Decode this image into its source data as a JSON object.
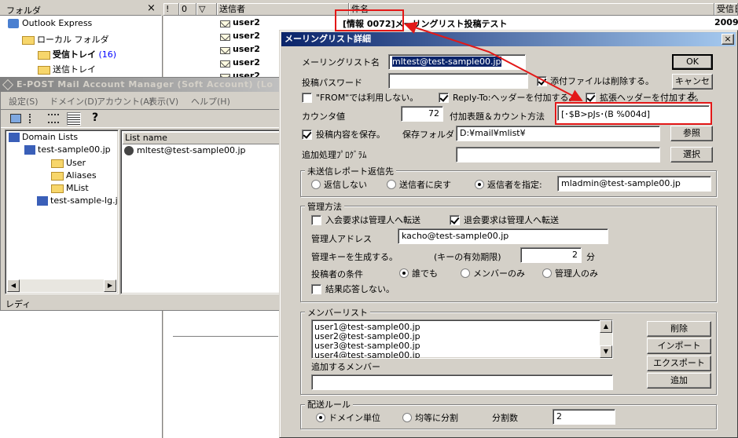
{
  "outlook": {
    "folder_header": "フォルダ",
    "close_label": "×",
    "tree": [
      {
        "label": "Outlook Express"
      },
      {
        "label": "ローカル フォルダ"
      },
      {
        "label": "受信トレイ",
        "count": "(16)"
      },
      {
        "label": "送信トレイ"
      }
    ],
    "columns": [
      "!",
      "0",
      "▽",
      "送信者",
      "件名",
      "受信日"
    ],
    "messages": [
      {
        "sender": "user2",
        "subject": "[情報 0072]メーリングリスト投稿テスト",
        "date": "2009/"
      },
      {
        "sender": "user2",
        "subject": "",
        "date": ""
      },
      {
        "sender": "user2",
        "subject": "",
        "date": ""
      },
      {
        "sender": "user2",
        "subject": "",
        "date": ""
      },
      {
        "sender": "user2",
        "subject": "",
        "date": ""
      }
    ]
  },
  "manager": {
    "title": "E-POST Mail Account Manager (Soft Account) (Lo",
    "menu": [
      "設定(S)",
      "ドメイン(D)",
      "アカウント(A)",
      "表示(V)",
      "ヘルプ(H)"
    ],
    "toolbar_help": "?",
    "tree": [
      {
        "label": "Domain Lists"
      },
      {
        "label": "test-sample00.jp"
      },
      {
        "label": "User"
      },
      {
        "label": "Aliases"
      },
      {
        "label": "MList"
      },
      {
        "label": "test-sample-lg.j"
      }
    ],
    "list_header": "List name",
    "list_items": [
      "mltest@test-sample00.jp"
    ],
    "status": "レディ"
  },
  "dialog": {
    "title": "メーリングリスト詳細",
    "close_label": "×",
    "ml_name_label": "メーリングリスト名",
    "ml_name_value": "mltest@test-sample00.jp",
    "post_password_label": "投稿パスワード",
    "post_password_value": "",
    "delete_attach_label": "添付ファイルは削除する。",
    "ok_label": "OK",
    "cancel_label": "キャンセル",
    "from_unused_label": "\"FROM\"では利用しない。",
    "reply_to_label": "Reply-To:ヘッダーを付加する。",
    "ext_header_label": "拡張ヘッダーを付加する。",
    "counter_label": "カウンタ値",
    "counter_value": "72",
    "subject_format_label": "付加表題＆カウント方法",
    "subject_format_value": "[･$B>pJs･(B %004d]",
    "save_post_label": "投稿内容を保存。",
    "save_folder_label": "保存フォルダ",
    "save_folder_value": "D:¥mail¥mlist¥",
    "browse_label": "参照",
    "extra_program_label": "追加処理ﾌﾟﾛｸﾞﾗﾑ",
    "extra_program_value": "",
    "select_label": "選択",
    "undelivered_group": "未送信レポート返信先",
    "undelivered_options": [
      "返信しない",
      "送信者に戻す",
      "返信者を指定:"
    ],
    "undelivered_address": "mladmin@test-sample00.jp",
    "admin_group": "管理方法",
    "join_forward_label": "入会要求は管理人へ転送",
    "leave_forward_label": "退会要求は管理人へ転送",
    "admin_address_label": "管理人アドレス",
    "admin_address_value": "kacho@test-sample00.jp",
    "admin_key_label": "管理キーを生成する。",
    "key_expiry_label": "(キーの有効期限)",
    "key_expiry_value": "2",
    "key_expiry_unit": "分",
    "poster_condition_label": "投稿者の条件",
    "poster_options": [
      "誰でも",
      "メンバーのみ",
      "管理人のみ"
    ],
    "result_reply_label": "結果応答しない。",
    "member_group": "メンバーリスト",
    "members": [
      "user1@test-sample00.jp",
      "user2@test-sample00.jp",
      "user3@test-sample00.jp",
      "user4@test-sample00.jp"
    ],
    "delete_label": "削除",
    "import_label": "インポート",
    "export_label": "エクスポート",
    "add_member_label": "追加するメンバー",
    "add_member_value": "",
    "add_label": "追加",
    "delivery_group": "配送ルール",
    "delivery_options": [
      "ドメイン単位",
      "均等に分割"
    ],
    "split_count_label": "分割数",
    "split_count_value": "2"
  },
  "colors": {
    "highlight_red": "#e31818",
    "title_blue": "#0a246a",
    "selection": "#0a246a"
  },
  "icons": [
    "close-icon",
    "envelope-icon",
    "folder-icon",
    "inbox-icon",
    "outbox-icon",
    "outlook-icon",
    "help-icon",
    "server-icon",
    "member-icon",
    "arrow-icon"
  ]
}
